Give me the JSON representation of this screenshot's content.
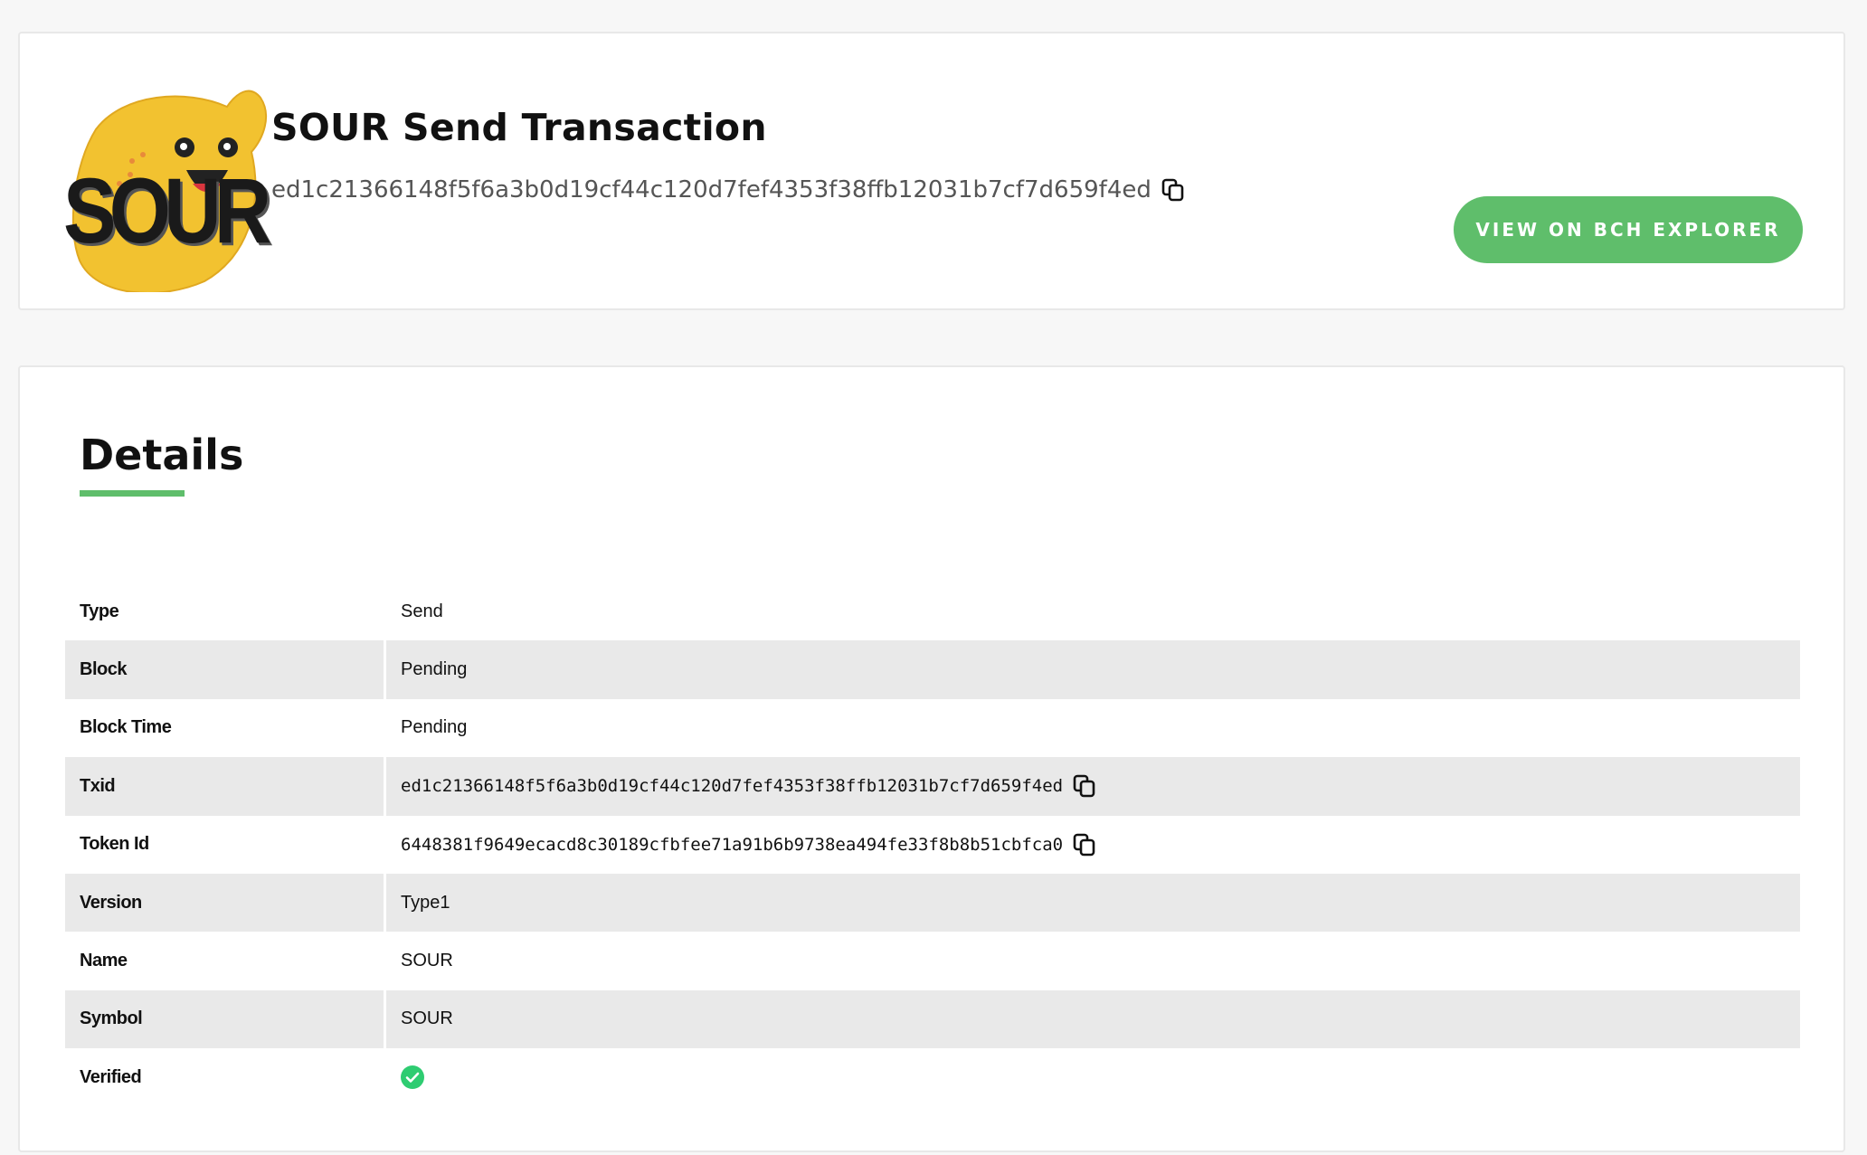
{
  "header": {
    "title": "SOUR Send Transaction",
    "txid": "ed1c21366148f5f6a3b0d19cf44c120d7fef4353f38ffb12031b7cf7d659f4ed",
    "logo_text": "SOUR",
    "explorer_button_label": "VIEW ON BCH EXPLORER"
  },
  "details": {
    "heading": "Details",
    "rows": [
      {
        "label": "Type",
        "value": "Send"
      },
      {
        "label": "Block",
        "value": "Pending"
      },
      {
        "label": "Block Time",
        "value": "Pending"
      },
      {
        "label": "Txid",
        "value": "ed1c21366148f5f6a3b0d19cf44c120d7fef4353f38ffb12031b7cf7d659f4ed"
      },
      {
        "label": "Token Id",
        "value": "6448381f9649ecacd8c30189cfbfee71a91b6b9738ea494fe33f8b8b51cbfca0"
      },
      {
        "label": "Version",
        "value": "Type1"
      },
      {
        "label": "Name",
        "value": "SOUR"
      },
      {
        "label": "Symbol",
        "value": "SOUR"
      },
      {
        "label": "Verified",
        "value": ""
      }
    ]
  },
  "icons": {
    "copy": "copy-icon",
    "verified": "check-circle-icon"
  },
  "colors": {
    "accent": "#5fbe6b",
    "row_shade": "#e9e9e9",
    "verified": "#2ecc71"
  }
}
